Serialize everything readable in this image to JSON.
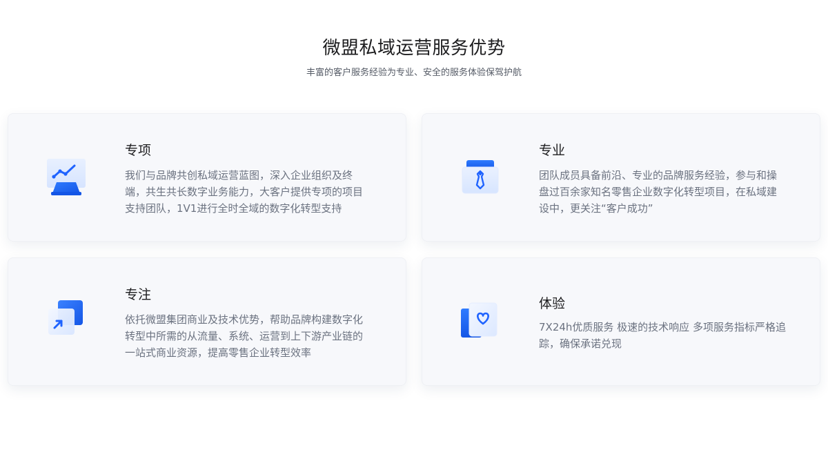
{
  "header": {
    "title": "微盟私域运营服务优势",
    "subtitle": "丰富的客户服务经验为专业、安全的服务体验保驾护航"
  },
  "cards": [
    {
      "heading": "专项",
      "text": "我们与品牌共创私域运营蓝图，深入企业组织及终端，共生共长数字业务能力，大客户提供专项的项目支持团队，1V1进行全时全域的数字化转型支持",
      "icon": "chart-laptop-icon"
    },
    {
      "heading": "专业",
      "text": "团队成员具备前沿、专业的品牌服务经验，参与和操盘过百余家知名零售企业数字化转型项目，在私域建设中，更关注“客户成功”",
      "icon": "tie-badge-icon"
    },
    {
      "heading": "专注",
      "text": "依托微盟集团商业及技术优势，帮助品牌构建数字化转型中所需的从流量、系统、运营到上下游产业链的一站式商业资源，提高零售企业转型效率",
      "icon": "arrow-card-icon"
    },
    {
      "heading": "体验",
      "text": "7X24h优质服务 极速的技术响应 多项服务指标严格追踪，确保承诺兑现",
      "icon": "heart-card-icon"
    }
  ],
  "colors": {
    "accent": "#1f6bff",
    "card_bg": "#f7f8fb",
    "heading": "#1d1d1f",
    "body_text": "#6b7280"
  }
}
